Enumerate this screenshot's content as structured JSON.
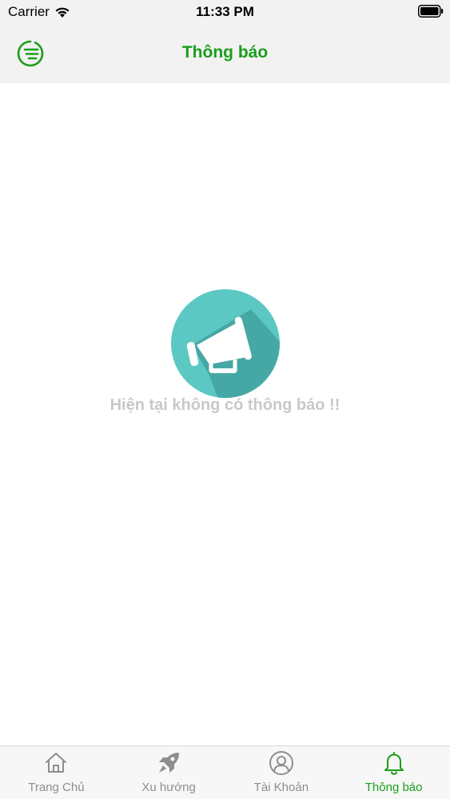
{
  "status_bar": {
    "carrier": "Carrier",
    "time": "11:33 PM"
  },
  "nav": {
    "title": "Thông báo",
    "menu_icon": "menu-lines-icon"
  },
  "empty_state": {
    "icon": "megaphone-icon",
    "message": "Hiện tại không có thông báo !!"
  },
  "tabs": [
    {
      "label": "Trang Chủ",
      "icon": "home-icon",
      "active": false
    },
    {
      "label": "Xu hướng",
      "icon": "rocket-icon",
      "active": false
    },
    {
      "label": "Tài Khoản",
      "icon": "user-icon",
      "active": false
    },
    {
      "label": "Thông báo",
      "icon": "bell-icon",
      "active": true
    }
  ],
  "colors": {
    "accent": "#1a9e1a",
    "inactive": "#8e8e8e",
    "empty_text": "#c8c8c8",
    "megaphone_bg": "#5cc8c3"
  }
}
